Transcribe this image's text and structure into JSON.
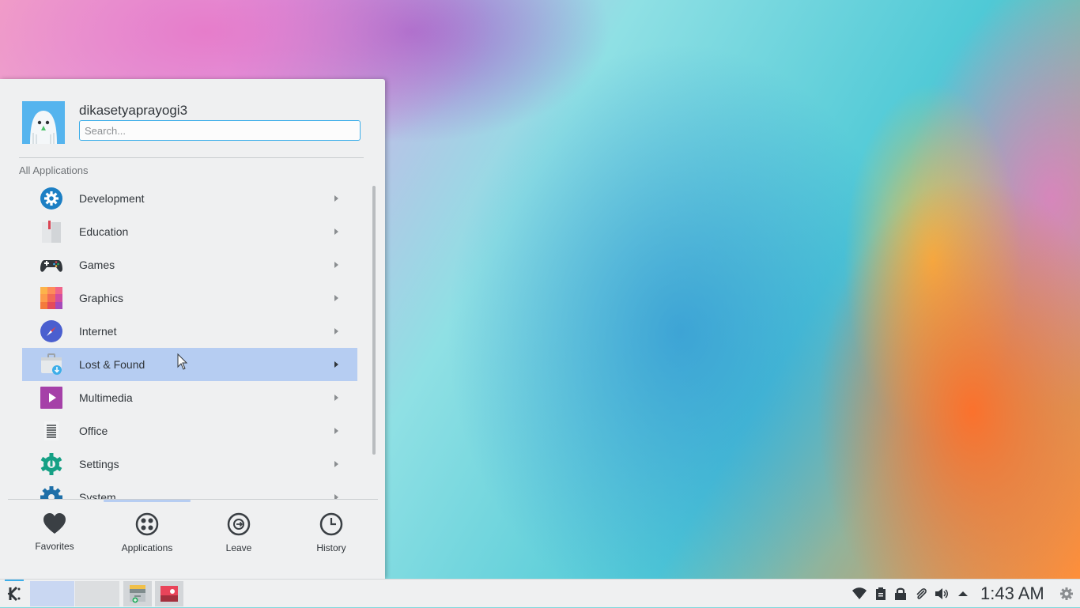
{
  "menu": {
    "username": "dikasetyaprayogi3",
    "search_placeholder": "Search...",
    "section_title": "All Applications",
    "items": [
      {
        "label": "Development",
        "icon": "development-icon"
      },
      {
        "label": "Education",
        "icon": "education-icon"
      },
      {
        "label": "Games",
        "icon": "gamepad-icon"
      },
      {
        "label": "Graphics",
        "icon": "graphics-icon"
      },
      {
        "label": "Internet",
        "icon": "compass-icon"
      },
      {
        "label": "Lost & Found",
        "icon": "lost-found-icon",
        "active": true
      },
      {
        "label": "Multimedia",
        "icon": "multimedia-icon"
      },
      {
        "label": "Office",
        "icon": "office-icon"
      },
      {
        "label": "Settings",
        "icon": "settings-icon"
      },
      {
        "label": "System",
        "icon": "system-icon"
      }
    ],
    "tabs": [
      {
        "label": "Favorites",
        "icon": "heart-icon"
      },
      {
        "label": "Applications",
        "icon": "applications-icon",
        "active": true
      },
      {
        "label": "Leave",
        "icon": "leave-icon"
      },
      {
        "label": "History",
        "icon": "clock-icon"
      }
    ]
  },
  "taskbar": {
    "clock": "1:43 AM",
    "tray_icons": [
      "wifi-icon",
      "clipboard-icon",
      "lock-icon",
      "paperclip-icon",
      "volume-icon",
      "expand-tray-icon",
      "panel-settings-icon"
    ]
  },
  "colors": {
    "accent": "#3daee9",
    "highlight": "#b6cdf2",
    "panel_bg": "#eff0f1",
    "text": "#31363b"
  }
}
